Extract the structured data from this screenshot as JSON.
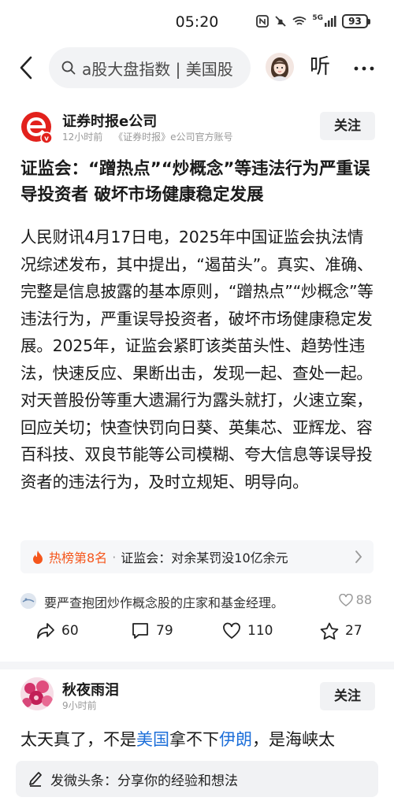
{
  "status_bar": {
    "time": "05:20",
    "network": "5G",
    "battery": "93"
  },
  "nav": {
    "search_placeholder": "a股大盘指数 | 美国股",
    "listen_label": "听"
  },
  "article": {
    "author": {
      "name": "证券时报e公司",
      "time": "12小时前",
      "source": "《证券时报》e公司官方账号",
      "follow_label": "关注"
    },
    "title": "证监会：“蹭热点”“炒概念”等违法行为严重误导投资者 破坏市场健康稳定发展",
    "body": "人民财讯4月17日电，2025年中国证监会执法情况综述发布，其中提出，“遏苗头”。真实、准确、完整是信息披露的基本原则，“蹭热点”“炒概念”等违法行为，严重误导投资者，破坏市场健康稳定发展。2025年，证监会紧盯该类苗头性、趋势性违法，快速反应、果断出击，发现一起、查处一起。对天普股份等重大遗漏行为露头就打，火速立案，回应关切；快查快罚向日葵、英集芯、亚辉龙、容百科技、双良节能等公司模糊、夸大信息等误导投资者的违法行为，及时立规矩、明导向。",
    "hot_topic": {
      "rank_label": "热榜第8名",
      "separator": "·",
      "text": "证监会：对余某罚没10亿余元"
    },
    "related_comment": {
      "text": "要严查抱团炒作概念股的庄家和基金经理。",
      "likes": "88"
    },
    "actions": {
      "share_count": "60",
      "comment_count": "79",
      "like_count": "110",
      "favorite_count": "27"
    }
  },
  "post2": {
    "user": {
      "name": "秋夜雨泪",
      "time": "9小时前",
      "follow_label": "关注"
    },
    "text_part1": "太天真了，不是",
    "link1": "美国",
    "text_part2": "拿不下",
    "link2": "伊朗",
    "text_part3": "，是海峡太"
  },
  "composer": {
    "placeholder": "发微头条：分享你的经验和想法"
  }
}
